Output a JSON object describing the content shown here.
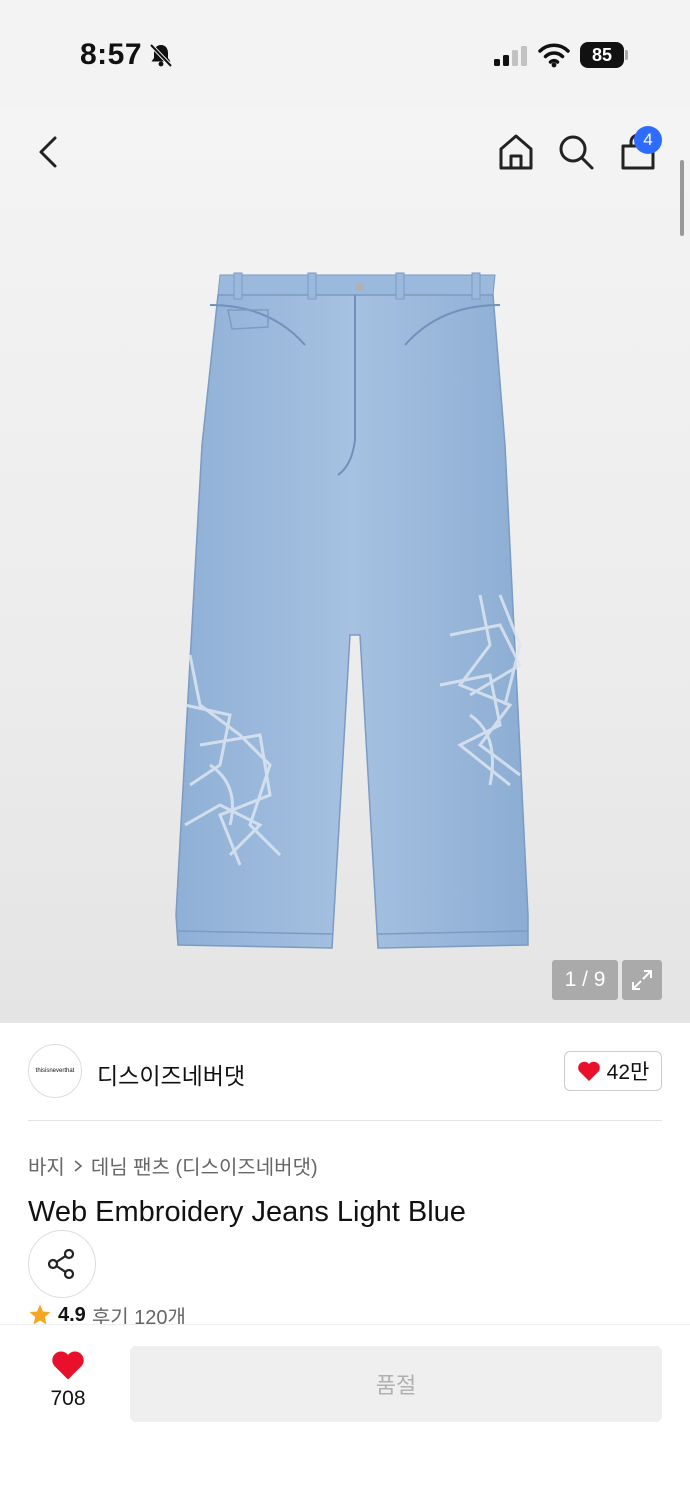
{
  "status_bar": {
    "time": "8:57",
    "battery": "85",
    "icons": [
      "bell-slash-icon",
      "signal-icon",
      "wifi-icon",
      "battery-icon"
    ]
  },
  "header": {
    "icons": [
      "back-arrow-icon",
      "home-icon",
      "search-icon",
      "shopping-bag-icon"
    ],
    "cart_count": "4"
  },
  "gallery": {
    "counter": "1 / 9",
    "current_index": 1,
    "total": 9
  },
  "brand": {
    "logo_text": "thisisneverthat",
    "name": "디스이즈네버댓",
    "likes": "42만"
  },
  "breadcrumb": {
    "category": "바지",
    "subcategory": "데님 팬츠 (디스이즈네버댓)"
  },
  "product": {
    "title": "Web Embroidery Jeans Light Blue",
    "rating": "4.9",
    "reviews": "후기 120개"
  },
  "bottom_bar": {
    "wish_count": "708",
    "buy_label": "품절"
  },
  "colors": {
    "accent_blue": "#2e6bff",
    "heart_red": "#e8102a",
    "star_orange": "#f5a623",
    "denim": "#93b3d8"
  }
}
